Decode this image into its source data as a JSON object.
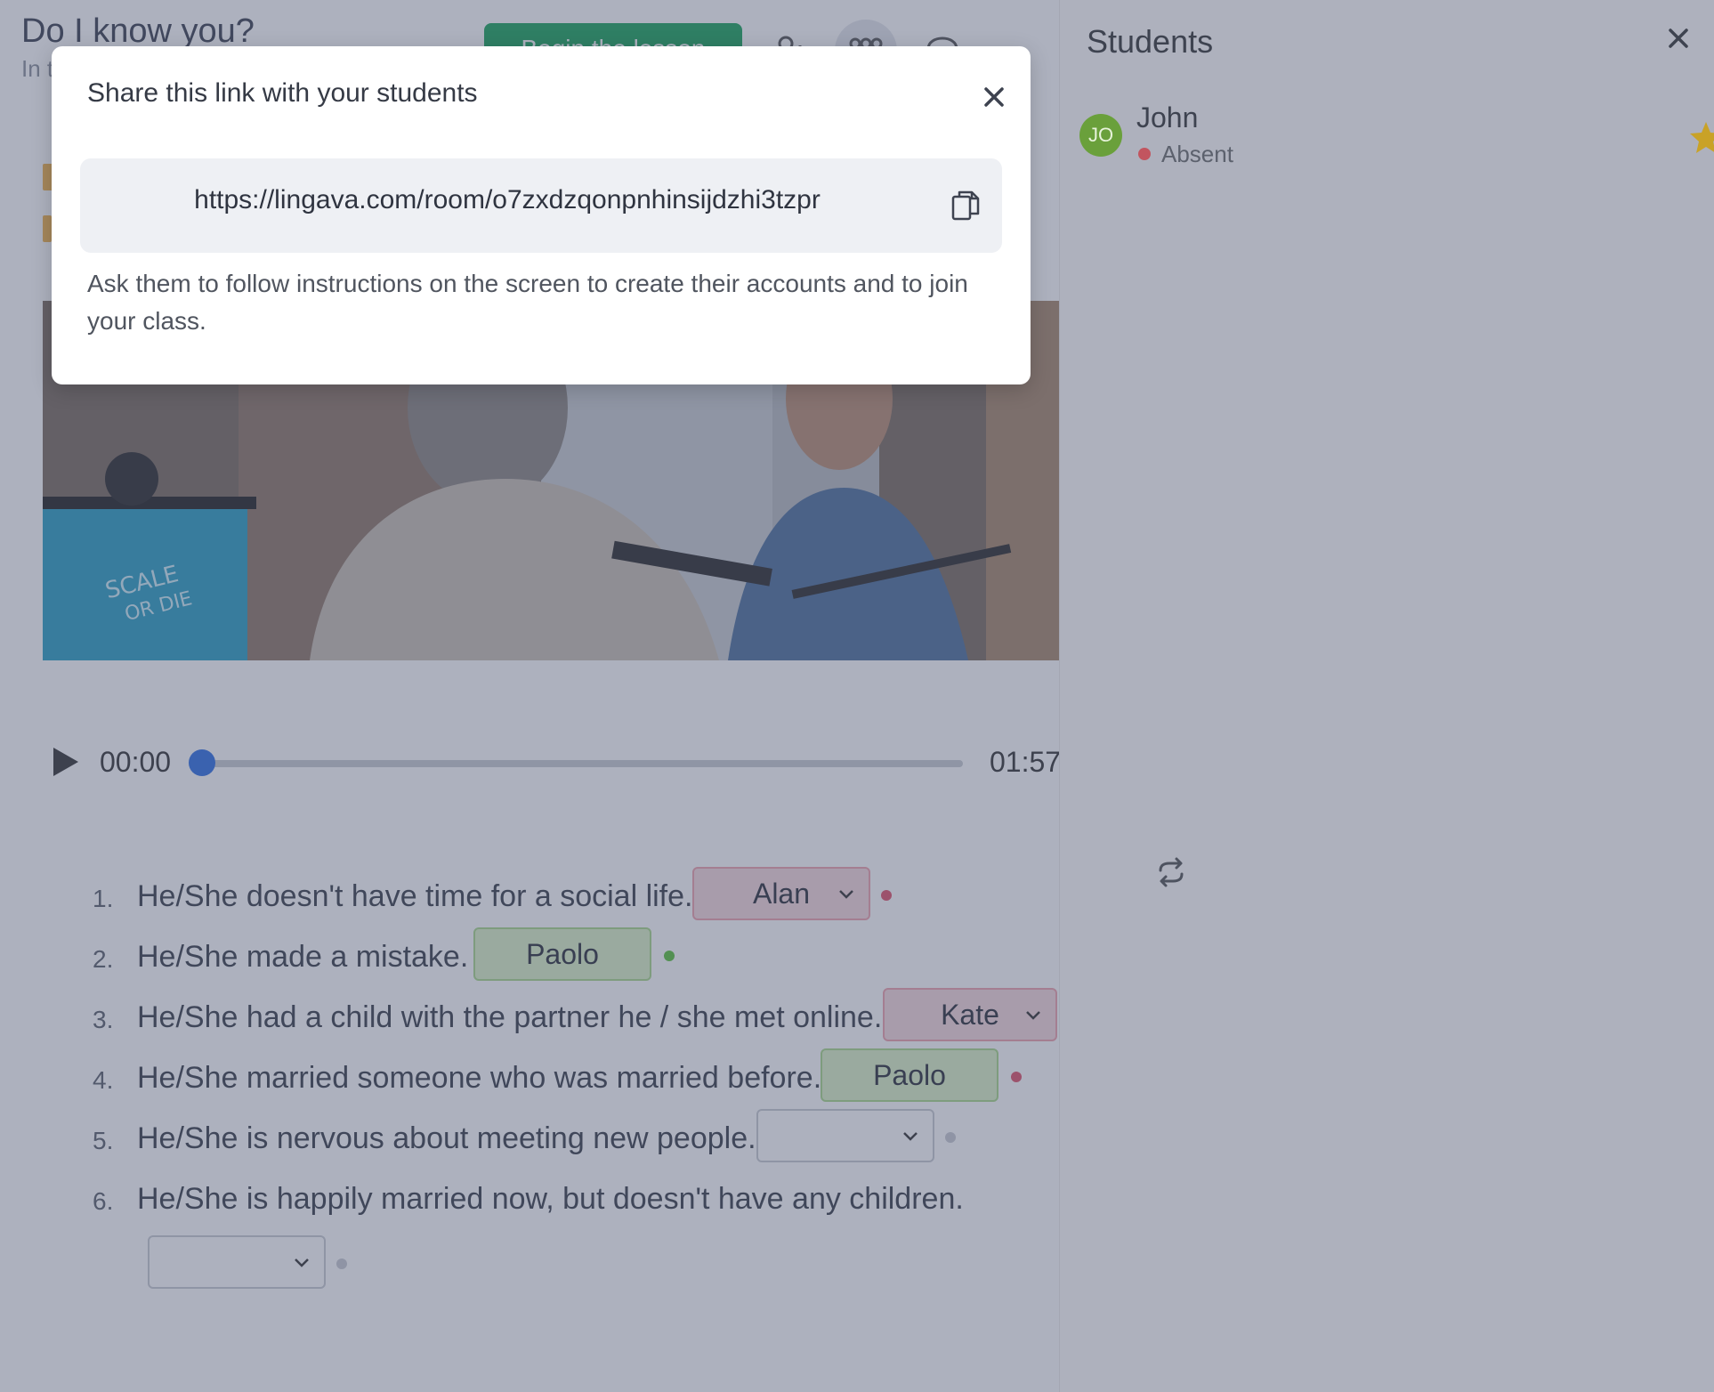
{
  "lesson": {
    "title": "Do I know you?",
    "subtitle": "In t",
    "begin_button": "Begin the lesson"
  },
  "player": {
    "current_time": "00:00",
    "duration": "01:57",
    "progress": 0.0
  },
  "questions": [
    {
      "num": "1.",
      "text": "He/She doesn't have time for a social life.",
      "answer": "Alan",
      "state": "wrong",
      "status_color": "#e0536a"
    },
    {
      "num": "2.",
      "text": "He/She made a mistake.",
      "answer": "Paolo",
      "state": "right",
      "status_color": "#5cc33c"
    },
    {
      "num": "3.",
      "text": "He/She had a child with the partner he / she met online.",
      "answer": "Kate",
      "state": "wrong",
      "status_color": "#e0536a"
    },
    {
      "num": "4.",
      "text": "He/She married someone who was married before.",
      "answer": "Paolo",
      "state": "right",
      "status_color": "#e0536a"
    },
    {
      "num": "5.",
      "text": "He/She is nervous about meeting new people.",
      "answer": "",
      "state": "empty",
      "status_color": "#c8cbd1"
    },
    {
      "num": "6.",
      "text": "He/She is happily married now, but doesn't have any children.",
      "answer": "",
      "state": "empty",
      "status_color": "#c8cbd1"
    }
  ],
  "sidebar": {
    "title": "Students",
    "students": [
      {
        "initials": "JO",
        "name": "John",
        "status": "Absent",
        "status_color": "#c2555f",
        "favorite": true
      }
    ]
  },
  "modal": {
    "title": "Share this link with your students",
    "link": "https://lingava.com/room/o7zxdzqonpnhinsijdzhi3tzpr",
    "description": "Ask them to follow instructions on the screen to create their accounts and to join your class."
  },
  "colors": {
    "accent_green": "#1aa55b",
    "progress_blue": "#2f6fe4",
    "wrong_bg": "#f6d9dd",
    "right_bg": "#dcf2c6",
    "star": "#c9a227"
  },
  "icons": [
    "add-user-icon",
    "students-icon",
    "chat-icon",
    "play-icon",
    "chevron-down-icon",
    "close-icon",
    "copy-icon",
    "star-icon",
    "refresh-icon"
  ]
}
